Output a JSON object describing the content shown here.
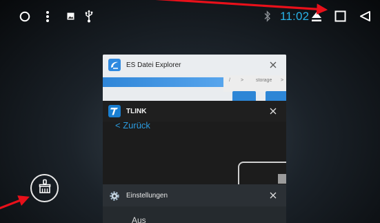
{
  "status_bar": {
    "time": "11:02",
    "icons": {
      "home": "home-circle-icon",
      "menu": "more-vert-icon",
      "image": "image-notification-icon",
      "usb": "usb-icon",
      "bluetooth": "bluetooth-icon",
      "eject": "eject-icon",
      "recents": "recents-square-icon",
      "back": "back-triangle-icon"
    },
    "time_color": "#29b2e8"
  },
  "recents": {
    "cards": [
      {
        "title": "ES Datei Explorer",
        "icon": "es-file-explorer-icon",
        "breadcrumb": [
          "/",
          ">",
          "storage",
          ">"
        ]
      },
      {
        "title": "TLINK",
        "icon": "tlink-icon",
        "content_link": "< Zurück"
      },
      {
        "title": "Einstellungen",
        "icon": "settings-gear-icon",
        "content_value": "Aus"
      }
    ],
    "close_icon": "close-icon",
    "clear_all_icon": "broom-clear-all-icon"
  },
  "annotations": {
    "arrow_color": "#e8101a",
    "arrows": [
      "arrow-to-recents-button",
      "arrow-to-clear-all-button"
    ]
  }
}
